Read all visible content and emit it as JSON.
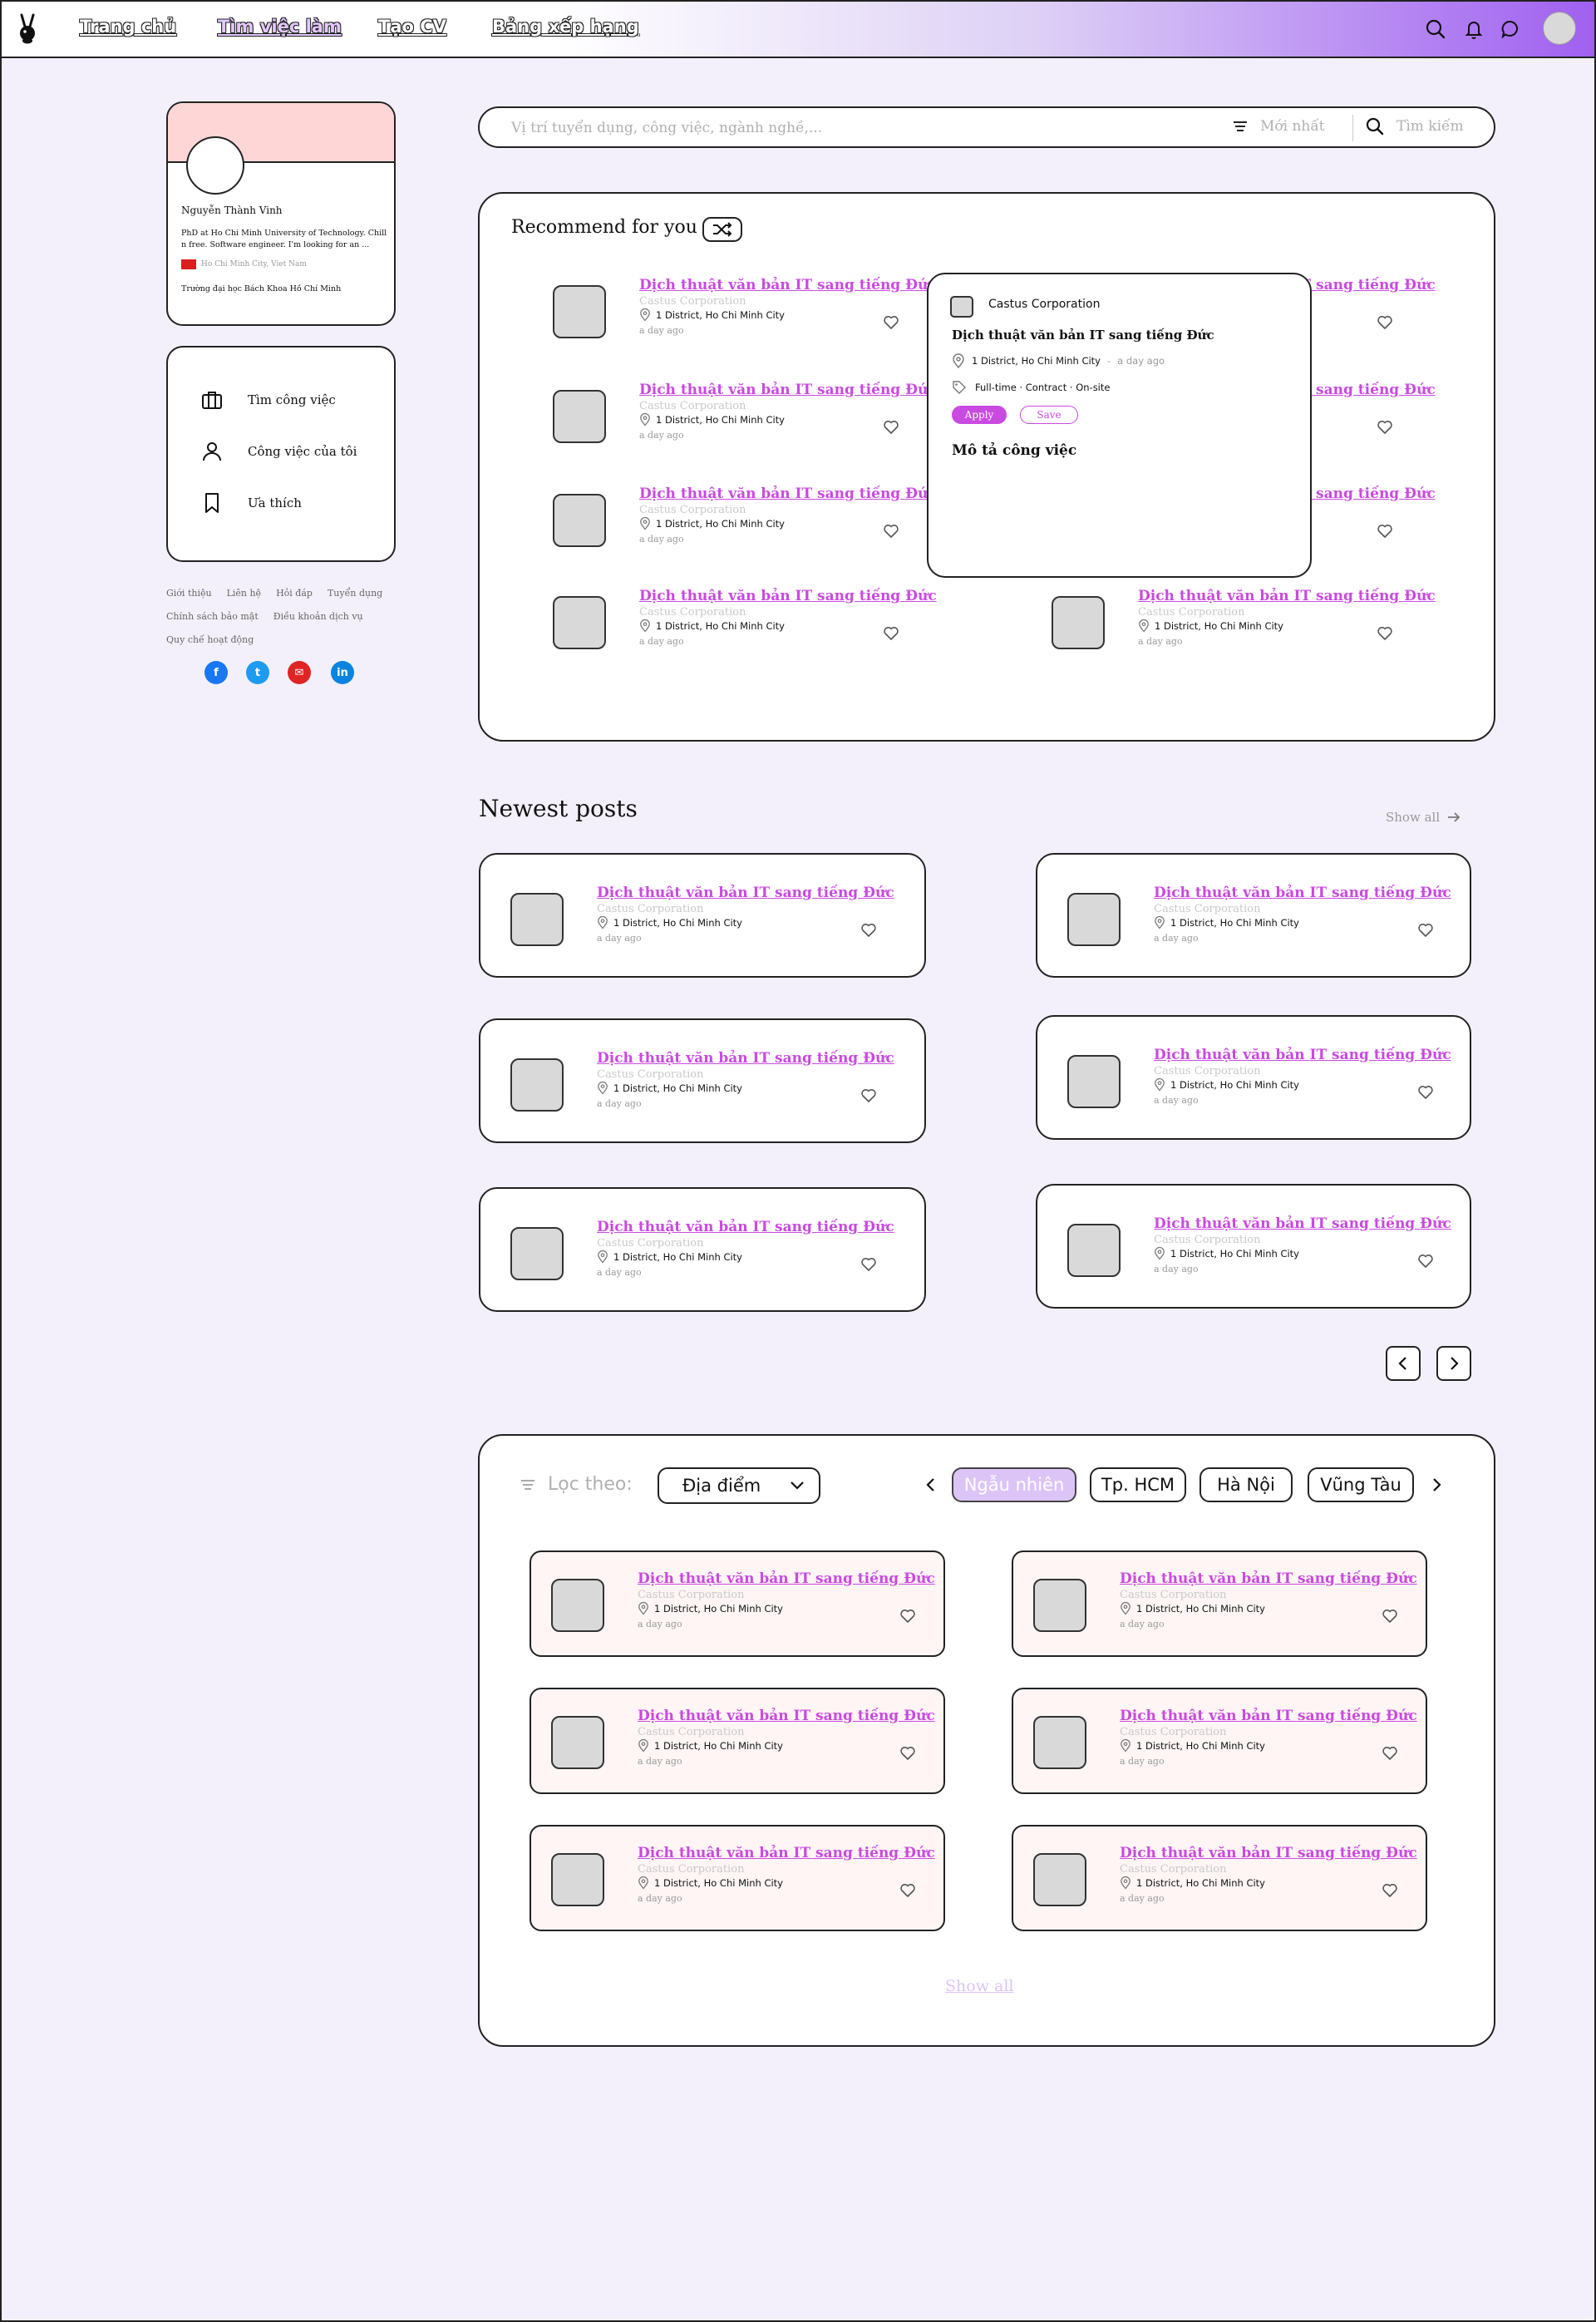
{
  "nav": {
    "links": [
      "Trang chủ",
      "Tìm việc làm",
      "Tạo CV",
      "Bảng xếp hạng"
    ],
    "active_index": 1,
    "icons": [
      "search-icon",
      "bell-icon",
      "chat-icon",
      "avatar"
    ]
  },
  "profile": {
    "name": "Nguyễn Thành Vinh",
    "bio": "PhD at Ho Chi Minh University of Technology. Chill n free. Software engineer. I'm looking for an ...",
    "location": "Ho Chi Minh City, Viet Nam",
    "school": "Trường đại học Bách Khoa Hồ Chí Minh"
  },
  "side_menu": [
    {
      "label": "Tìm công việc",
      "icon": "briefcase-icon"
    },
    {
      "label": "Công việc của tôi",
      "icon": "user-icon"
    },
    {
      "label": "Ưa thích",
      "icon": "bookmark-icon"
    }
  ],
  "footer_links": [
    "Giới thiệu",
    "Liên hệ",
    "Hỏi đáp",
    "Tuyển dụng",
    "Chính sách bảo mật",
    "Điều khoản dịch vụ",
    "Quy chế hoạt động"
  ],
  "social": [
    {
      "icon": "facebook-icon",
      "glyph": "f",
      "color": "#1877f2"
    },
    {
      "icon": "twitter-icon",
      "glyph": "t",
      "color": "#1d9bf0"
    },
    {
      "icon": "mail-icon",
      "glyph": "✉",
      "color": "#e02424"
    },
    {
      "icon": "linkedin-icon",
      "glyph": "in",
      "color": "#0a84e0"
    }
  ],
  "search": {
    "placeholder": "Vị trí tuyển dụng, công việc, ngành nghề,...",
    "sort_label": "Mới nhất",
    "button_label": "Tìm kiếm"
  },
  "job": {
    "title": "Dịch thuật văn bản IT sang tiếng Đức",
    "company": "Castus Corporation",
    "location": "1 District, Ho Chi Minh City",
    "time": "a day ago"
  },
  "recommend": {
    "title": "Recommend for you"
  },
  "popup": {
    "company": "Castus Corporation",
    "title": "Dịch thuật văn bản IT sang tiếng Đức",
    "location": "1 District, Ho Chi Minh City",
    "separator": "-",
    "time": "a day ago",
    "tags": "Full-time · Contract · On-site",
    "apply": "Apply",
    "save": "Save",
    "desc_heading": "Mô tả công việc"
  },
  "newest": {
    "title": "Newest posts",
    "show_all": "Show all"
  },
  "filter": {
    "label": "Lọc theo:",
    "select_value": "Địa điểm",
    "chips": [
      "Ngẫu nhiên",
      "Tp. HCM",
      "Hà Nội",
      "Vũng Tàu"
    ],
    "active_chip": 0,
    "show_all": "Show all"
  },
  "colors": {
    "accent": "#c94ae0",
    "nav_gradient_end": "#a060f0",
    "profile_banner": "#ffd6d6",
    "chip_active": "#dcc4f7",
    "page_bg": "#f3f0fb"
  }
}
